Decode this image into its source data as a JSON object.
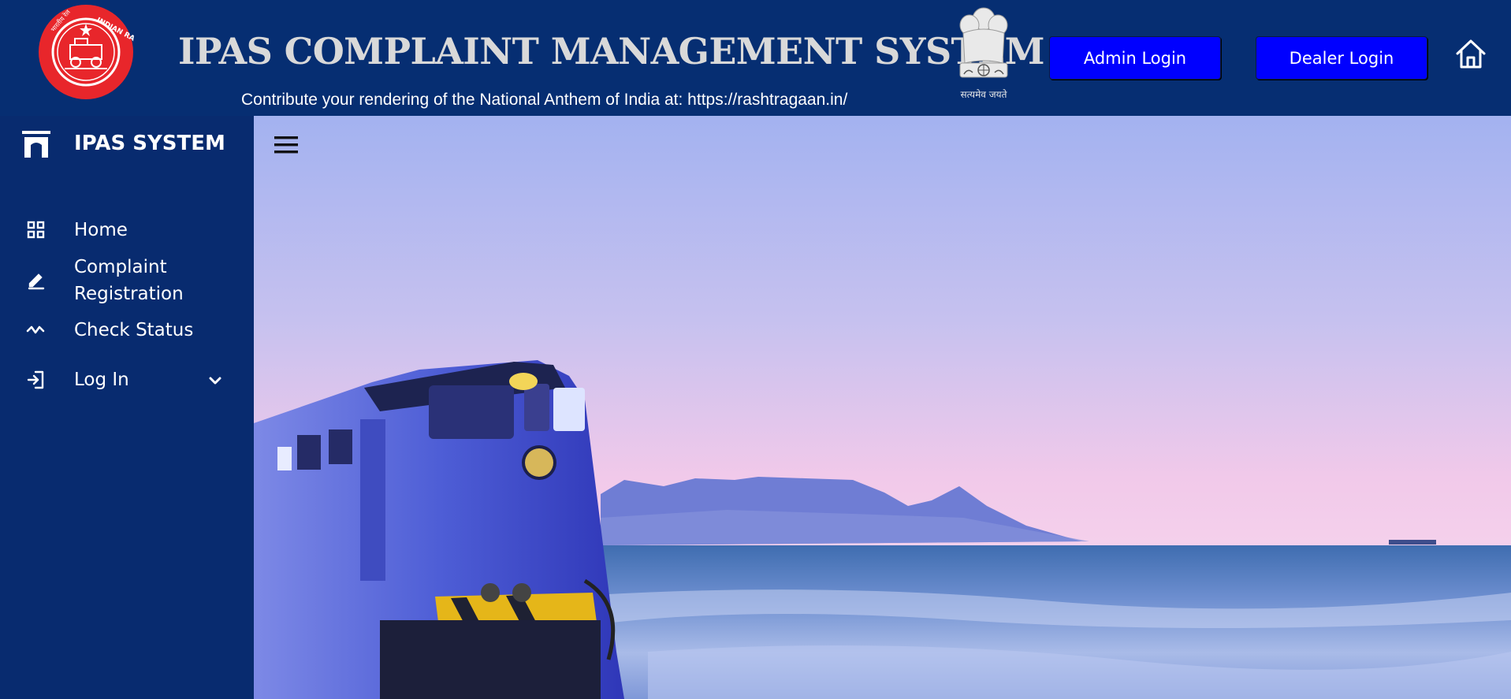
{
  "header": {
    "title": "IPAS COMPLAINT MANAGEMENT SYSTEM",
    "subtitle": "Contribute your rendering of the National Anthem of India at: https://rashtragaan.in/",
    "logo_text": "INDIAN RAILWAYS",
    "logo_text_hindi": "भारतीय रेल",
    "emblem_motto": "सत्यमेव जयते",
    "admin_login_label": "Admin Login",
    "dealer_login_label": "Dealer Login",
    "home_icon": "home-icon"
  },
  "sidebar": {
    "brand": "IPAS SYSTEM",
    "items": [
      {
        "label": "Home",
        "icon": "grid-icon"
      },
      {
        "label": "Complaint Registration",
        "icon": "edit-icon"
      },
      {
        "label": "Check Status",
        "icon": "activity-icon"
      },
      {
        "label": "Log In",
        "icon": "login-icon",
        "expandable": true
      }
    ]
  },
  "main": {
    "menu_icon": "hamburger-icon",
    "hero_image": "train-by-the-sea"
  },
  "colors": {
    "header_bg": "#062e72",
    "sidebar_bg": "#082b6f",
    "button_bg": "#0000ff",
    "title_color": "#d9d9d9",
    "logo_red": "#e8262b"
  }
}
